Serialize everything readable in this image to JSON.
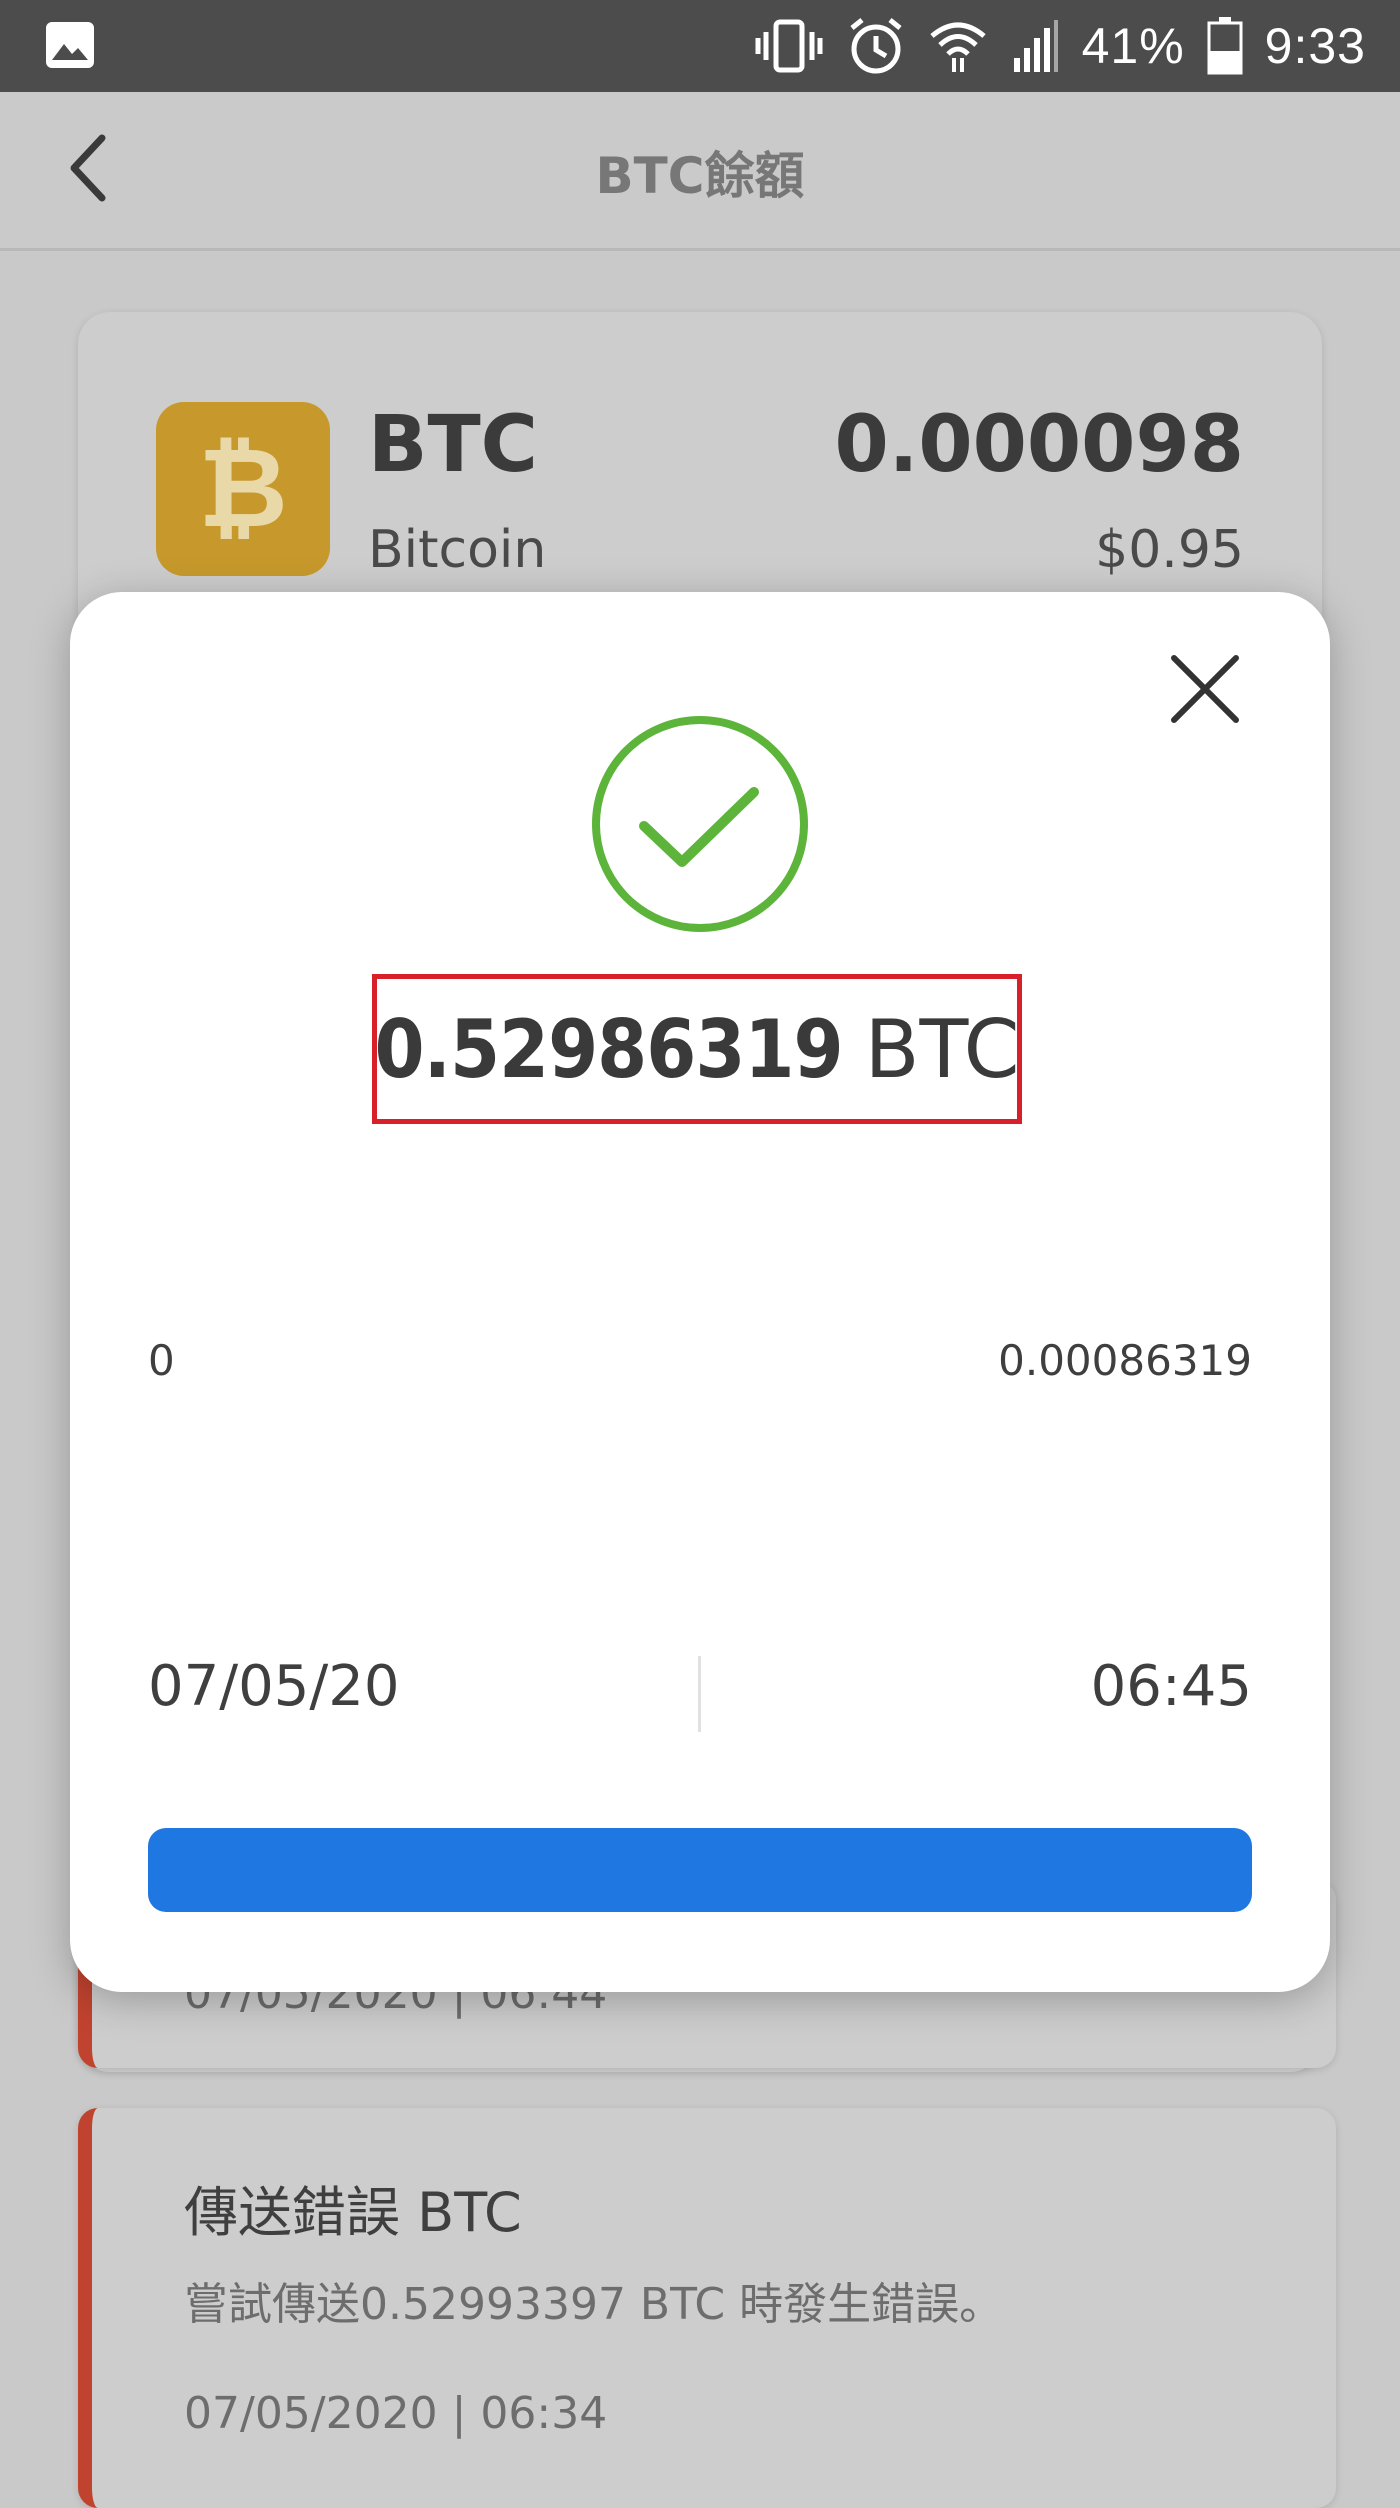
{
  "status_bar": {
    "battery": "41%",
    "time": "9:33",
    "icons": [
      "gallery-icon",
      "vibrate-icon",
      "alarm-icon",
      "wifi-icon",
      "signal-icon",
      "battery-icon"
    ]
  },
  "header": {
    "title": "BTC餘額",
    "back_icon": "chevron-left-icon"
  },
  "balance": {
    "symbol": "BTC",
    "name": "Bitcoin",
    "amount": "0.000098",
    "fiat": "$0.95",
    "logo_color": "#c7992c"
  },
  "modal": {
    "amount": "0.52986319",
    "unit": "BTC",
    "range_min": "0",
    "range_max": "0.00086319",
    "date": "07/05/20",
    "time": "06:45",
    "success_color": "#5db43a",
    "highlight_color": "#d7202a",
    "button_color": "#1f78e1"
  },
  "transactions": [
    {
      "stamp": "07/05/2020 | 06:44"
    },
    {
      "title": "傳送錯誤 BTC",
      "description": "嘗試傳送0.52993397 BTC 時發生錯誤。",
      "stamp": "07/05/2020 | 06:34"
    }
  ]
}
